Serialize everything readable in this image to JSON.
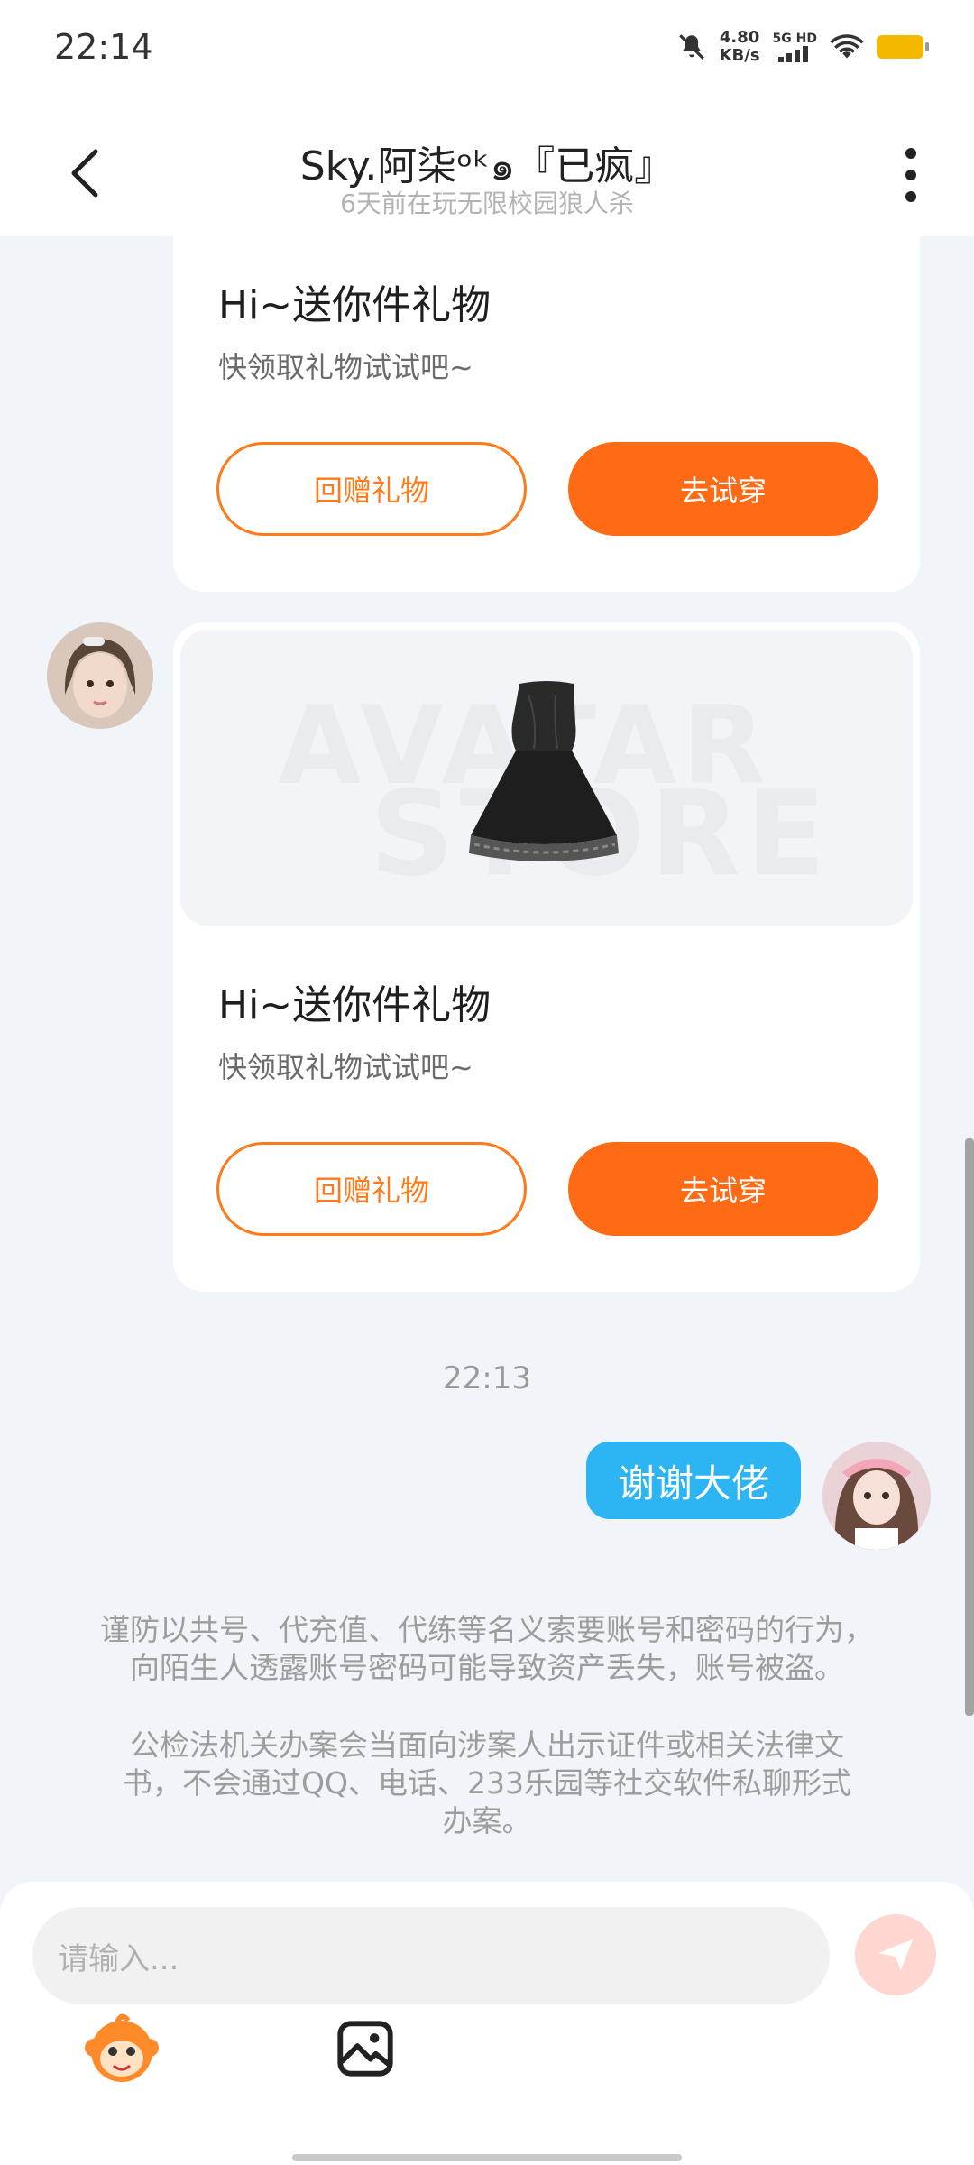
{
  "status_bar": {
    "time": "22:14",
    "net_speed_value": "4.80",
    "net_speed_unit": "KB/s",
    "signal_label": "5G HD",
    "icons": [
      "mute-bell-icon",
      "signal-icon",
      "wifi-icon",
      "battery-icon"
    ]
  },
  "header": {
    "title": "Sky.阿柒ᵒᵏ๑『已疯』",
    "subtitle": "6天前在玩无限校园狼人杀"
  },
  "gift_cards": [
    {
      "title": "Hi~送你件礼物",
      "subtitle": "快领取礼物试试吧~",
      "return_label": "回赠礼物",
      "try_label": "去试穿"
    },
    {
      "title": "Hi~送你件礼物",
      "subtitle": "快领取礼物试试吧~",
      "return_label": "回赠礼物",
      "try_label": "去试穿",
      "watermark_line1": "AVATAR",
      "watermark_line2": "STORE"
    }
  ],
  "timestamp": "22:13",
  "my_message": "谢谢大佬",
  "notice": {
    "line1": "谨防以共号、代充值、代练等名义索要账号和密码的行为，",
    "line2": "向陌生人透露账号密码可能导致资产丢失，账号被盗。",
    "line3": "公检法机关办案会当面向涉案人出示证件或相关法律文",
    "line4": "书，不会通过QQ、电话、233乐园等社交软件私聊形式",
    "line5": "办案。"
  },
  "input": {
    "placeholder": "请输入..."
  },
  "colors": {
    "accent_orange": "#ff6a14",
    "bubble_blue": "#2db4f2",
    "background": "#f1f4f8"
  }
}
